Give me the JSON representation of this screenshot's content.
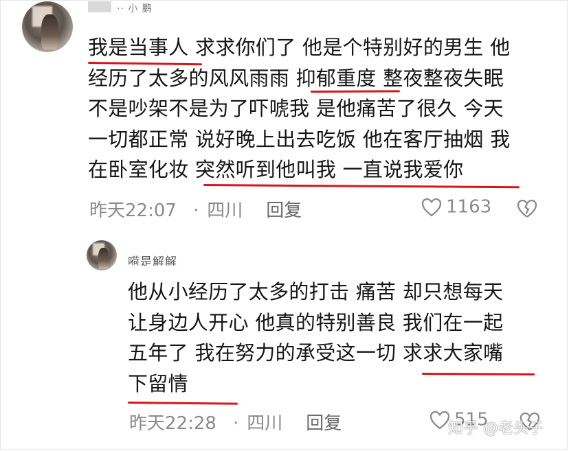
{
  "comment1": {
    "username": "·· 小 鹏",
    "lines": [
      "我是当事人 求求你们了 他是个特别好的男生 他",
      "经历了太多的风风雨雨 抑郁重度 整夜整夜失眠",
      "不是吵架不是为了吓唬我 是他痛苦了很久 今天",
      "一切都正常 说好晚上出去吃饭 他在客厅抽烟 我",
      "在卧室化妆 突然听到他叫我 一直说我爱你"
    ],
    "time": "昨天22:07",
    "separator": "·",
    "location": "四川",
    "reply_label": "回复",
    "like_count": "1163"
  },
  "comment2": {
    "username": "嗬是解解",
    "lines": [
      "他从小经历了太多的打击 痛苦 却只想每天",
      "让身边人开心 他真的特别善良 我们在一起",
      "五年了 我在努力的承受这一切 求求大家嘴",
      "下留情"
    ],
    "time": "昨天22:28",
    "separator": "·",
    "location": "四川",
    "reply_label": "回复",
    "like_count": "515"
  },
  "watermark": "知乎 @老头子",
  "colors": {
    "underline": "#d9141b",
    "meta_text": "#8a8a8a"
  },
  "icons": [
    "heart-icon",
    "broken-heart-icon"
  ]
}
